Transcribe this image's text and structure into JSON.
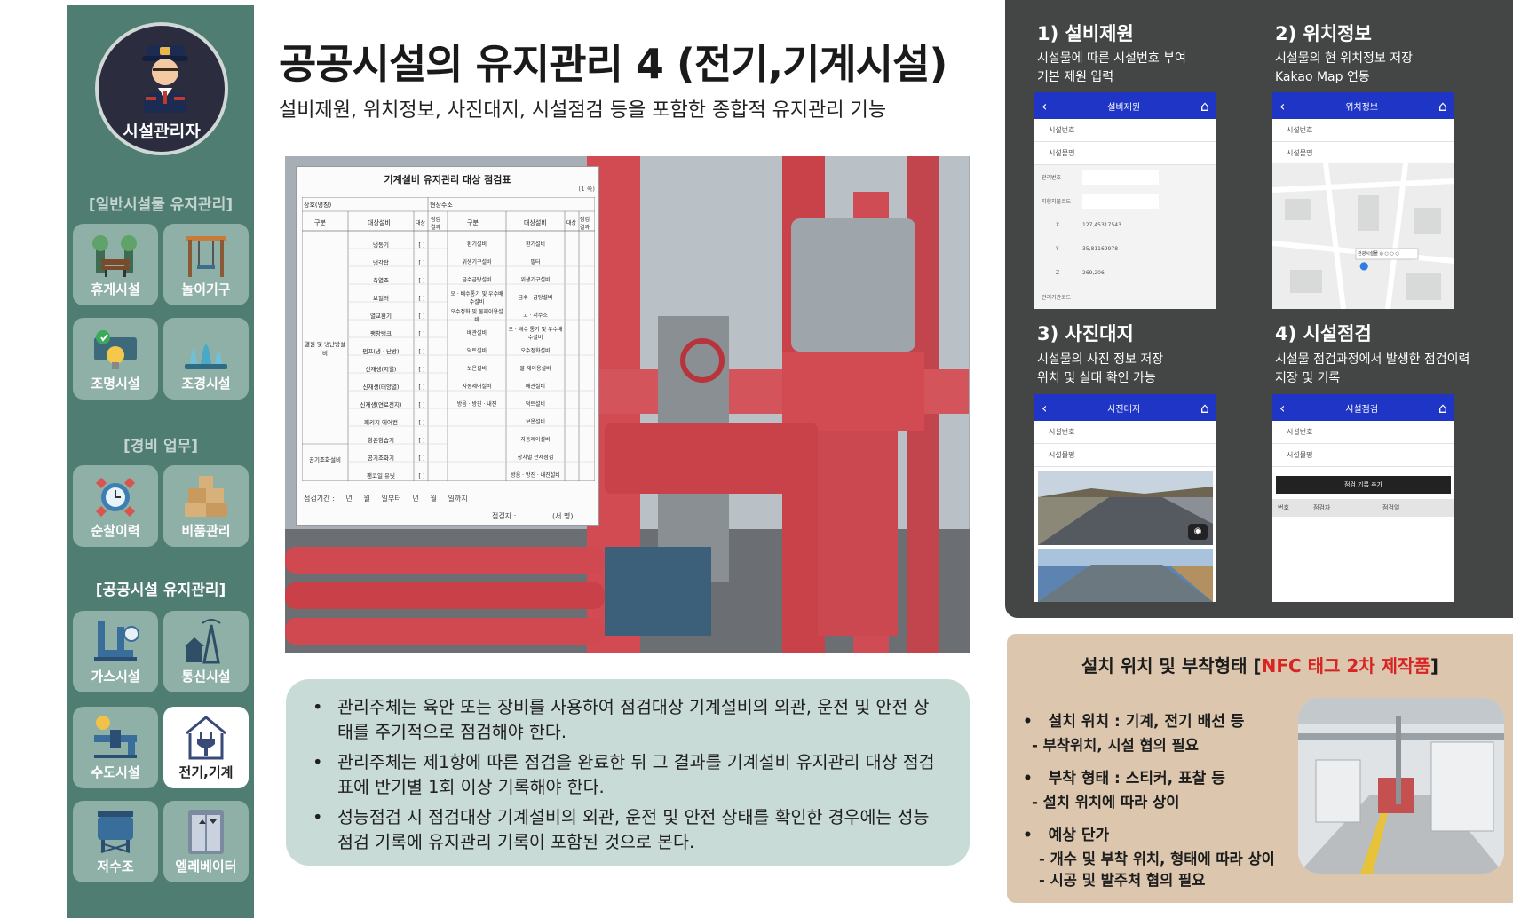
{
  "sidebar": {
    "profile_label": "시설관리자",
    "sections": {
      "general": "[일반시설물 유지관리]",
      "security": "[경비 업무]",
      "public": "[공공시설 유지관리]"
    },
    "tiles": [
      {
        "label": "휴게시설",
        "icon": "bench-park-icon"
      },
      {
        "label": "놀이기구",
        "icon": "swing-icon"
      },
      {
        "label": "조명시설",
        "icon": "lighting-icon"
      },
      {
        "label": "조경시설",
        "icon": "fountain-icon"
      },
      {
        "label": "순찰이력",
        "icon": "patrol-clock-icon"
      },
      {
        "label": "비품관리",
        "icon": "boxes-icon"
      },
      {
        "label": "가스시설",
        "icon": "gas-pipe-icon"
      },
      {
        "label": "통신시설",
        "icon": "telecom-tower-icon"
      },
      {
        "label": "수도시설",
        "icon": "water-pipe-icon"
      },
      {
        "label": "전기,기계",
        "icon": "electric-plug-icon"
      },
      {
        "label": "저수조",
        "icon": "water-tank-icon"
      },
      {
        "label": "엘레베이터",
        "icon": "elevator-icon"
      }
    ],
    "active_tile": "전기,기계"
  },
  "header": {
    "title": "공공시설의 유지관리 4 (전기,기계시설)",
    "subtitle": "설비제원, 위치정보, 사진대지, 시설점검 등을 포함한 종합적 유지관리 기능"
  },
  "sheet": {
    "title": "기계설비 유지관리 대상 점검표",
    "page_note": "(1 쪽)",
    "row1": [
      "상호(명칭)",
      "현장주소"
    ],
    "headers": [
      "구분",
      "대상설비",
      "대상",
      "점검결과",
      "구분",
      "대상설비",
      "대상",
      "점검결과"
    ],
    "group_left_1": "열원 및 냉난방설비",
    "group_left_2": "공기조화설비",
    "left_items": [
      "냉동기",
      "냉각탑",
      "축열조",
      "보일러",
      "열교환기",
      "팽창탱크",
      "펌프(냉 · 난방)",
      "신재생(지열)",
      "신재생(태양열)",
      "신재생(연료전지)",
      "패키지 에어컨",
      "항온항습기",
      "공기조화기",
      "팬코일 유닛"
    ],
    "right_groups": [
      "환기설비",
      "위생기구설비",
      "급수급탕설비",
      "오 · 배수통기 및 우수배수설비",
      "오수정화 및 물재이용설비",
      "배관설비",
      "덕트설비",
      "보온설비",
      "자동제어설비",
      "방음 · 방진 · 내진"
    ],
    "right_items": [
      "환기설비",
      "필터",
      "위생기구설비",
      "급수 · 급탕설비",
      "고 · 저수조",
      "오 · 배수 통기 및 우수배수설비",
      "오수정화설비",
      "물 재이용설비",
      "배관설비",
      "덕트설비",
      "보온설비",
      "자동제어설비",
      "장치별 관제점검",
      "방음 · 방진 · 내진설비"
    ],
    "checkbox": "[ ]",
    "period": [
      "점검기간 :",
      "년",
      "월",
      "일부터",
      "년",
      "월",
      "일까지"
    ],
    "inspector": [
      "점검자 :",
      "(서 명)"
    ]
  },
  "info_box": {
    "items": [
      "관리주체는 육안 또는 장비를 사용하여 점검대상 기계설비의 외관, 운전 및 안전 상태를 주기적으로 점검해야 한다.",
      "관리주체는 제1항에 따른 점검을 완료한 뒤 그 결과를 기계설비 유지관리 대상 점검표에 반기별 1회 이상 기록해야 한다.",
      "성능점검 시 점검대상 기계설비의 외관, 운전 및 안전 상태를 확인한 경우에는 성능점검 기록에 유지관리 기록이 포함된 것으로 본다."
    ]
  },
  "features": [
    {
      "title": "1) 설비제원",
      "desc": [
        "시설물에 따른 시설번호 부여",
        "기본 제원 입력"
      ],
      "screen": {
        "title": "설비제원",
        "rows": [
          "시설번호",
          "시설물명"
        ],
        "fields": [
          "관리번호",
          "지형지물코드",
          "X",
          "Y",
          "Z",
          "관리기관코드"
        ],
        "values": [
          "",
          "",
          "127,45317543",
          "35,81169978",
          "269,206",
          ""
        ]
      }
    },
    {
      "title": "2) 위치정보",
      "desc": [
        "시설물의 현 위치정보 저장",
        "Kakao Map 연동"
      ],
      "screen": {
        "title": "위치정보",
        "rows": [
          "시설번호",
          "시설물명"
        ],
        "map_pin_label": "관광시설물 ◎ ○ ○ ○"
      }
    },
    {
      "title": "3) 사진대지",
      "desc": [
        "시설물의 사진 정보 저장",
        "위치 및 실태 확인 가능"
      ],
      "screen": {
        "title": "사진대지",
        "rows": [
          "시설번호",
          "시설물명"
        ]
      }
    },
    {
      "title": "4) 시설점검",
      "desc": [
        "시설물 점검과정에서 발생한 점검이력",
        "저장 및 기록"
      ],
      "screen": {
        "title": "시설점검",
        "rows": [
          "시설번호",
          "시설물명"
        ],
        "button": "점검 기록 추가",
        "history_headers": [
          "번호",
          "점검자",
          "점검일"
        ]
      }
    }
  ],
  "nfc": {
    "title_main": "설치 위치 및 부착형태 [",
    "title_red": "NFC 태그 2차 제작품",
    "title_end": "]",
    "items": [
      {
        "label": "설치 위치 : 기계, 전기 배선 등",
        "sub": [
          "- 부착위치, 시설 협의 필요"
        ]
      },
      {
        "label": "부착 형태 : 스티커, 표찰 등",
        "sub": [
          "- 설치 위치에 따라 상이"
        ]
      },
      {
        "label": "예상 단가",
        "sub": [
          "- 개수 및 부착 위치, 형태에 따라 상이",
          "- 시공 및 발주처 협의 필요"
        ]
      }
    ]
  },
  "colors": {
    "sidebar": "#4f7d72",
    "tile": "#8fb0a6",
    "info_box": "#c9dbd6",
    "dark_panel": "#444545",
    "app_bar": "#1e35c6",
    "beige_panel": "#dcc6ad",
    "accent_red": "#d92424"
  }
}
